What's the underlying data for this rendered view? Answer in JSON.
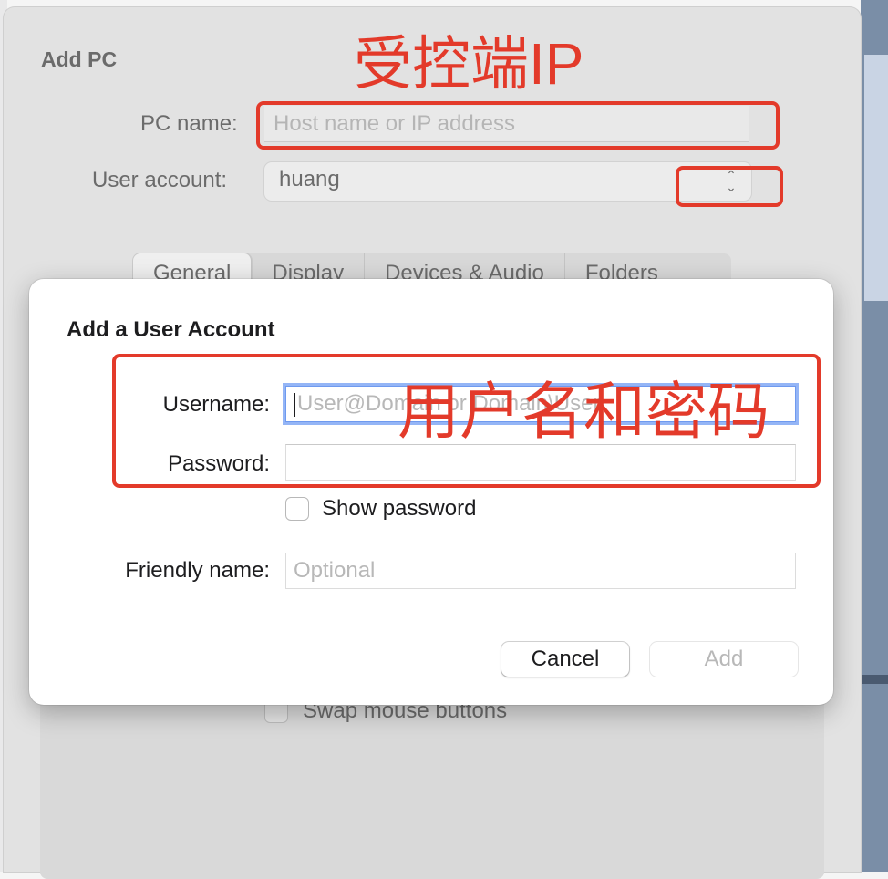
{
  "parent": {
    "title": "Add PC",
    "pc_name_label": "PC name:",
    "pc_name_placeholder": "Host name or IP address",
    "user_account_label": "User account:",
    "user_account_value": "huang",
    "tabs": [
      {
        "label": "General"
      },
      {
        "label": "Display"
      },
      {
        "label": "Devices & Audio"
      },
      {
        "label": "Folders"
      }
    ],
    "swap_label": "Swap mouse buttons"
  },
  "dialog": {
    "title": "Add a User Account",
    "username_label": "Username:",
    "username_placeholder": "User@Domain or Domain\\User",
    "password_label": "Password:",
    "show_password_label": "Show password",
    "friendly_label": "Friendly name:",
    "friendly_placeholder": "Optional",
    "cancel_label": "Cancel",
    "add_label": "Add"
  },
  "annotations": {
    "ip_text": "受控端IP",
    "credentials_text": "用户名和密码",
    "color": "#e33a2a"
  }
}
